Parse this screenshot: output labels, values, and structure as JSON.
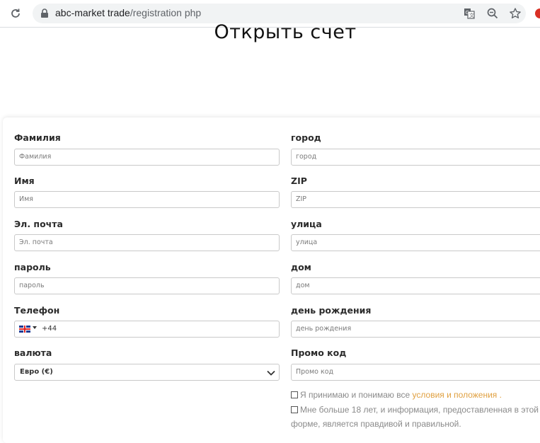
{
  "browser": {
    "url_host": "abc-market trade",
    "url_path": "/registration php"
  },
  "page": {
    "title": "Открыть счет"
  },
  "form": {
    "left": [
      {
        "label": "Фамилия",
        "placeholder": "Фамилия"
      },
      {
        "label": "Имя",
        "placeholder": "Имя"
      },
      {
        "label": "Эл. почта",
        "placeholder": "Эл. почта"
      },
      {
        "label": "пароль",
        "placeholder": "пароль"
      },
      {
        "label": "Телефон",
        "dial_code": "+44"
      },
      {
        "label": "валюта",
        "selected": "Евро (€)"
      }
    ],
    "right": [
      {
        "label": "город",
        "placeholder": "город"
      },
      {
        "label": "ZIP",
        "placeholder": "ZIP"
      },
      {
        "label": "улица",
        "placeholder": "улица"
      },
      {
        "label": "дом",
        "placeholder": "дом"
      },
      {
        "label": "день рождения",
        "placeholder": "день рождения"
      },
      {
        "label": "Промо код",
        "placeholder": "Промо код"
      }
    ],
    "terms": {
      "text": "Я принимаю и понимаю все",
      "link": "условия и положения",
      "suffix": "."
    },
    "age": {
      "line1": "Мне больше 18 лет, и информация, предоставленная в этой",
      "line2": "форме, является правдивой и правильной."
    }
  },
  "colors": {
    "link": "#e0a040",
    "field_border": "#c9c9c9"
  }
}
